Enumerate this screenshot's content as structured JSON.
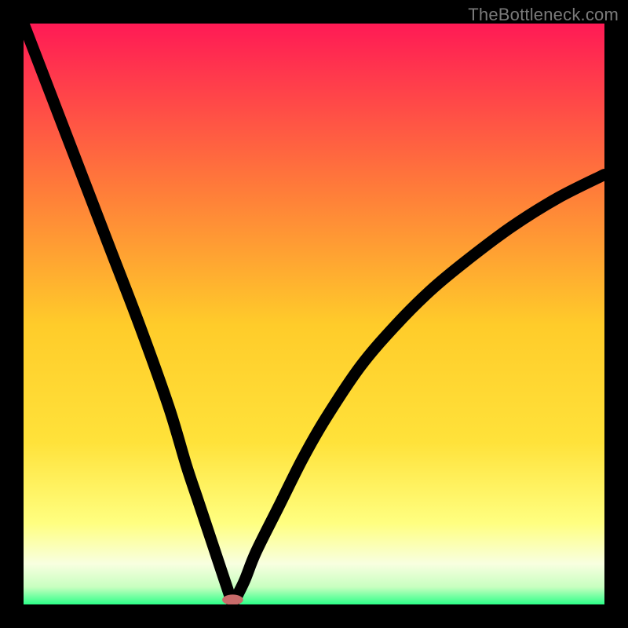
{
  "watermark": "TheBottleneck.com",
  "colors": {
    "frame": "#000000",
    "gradient_top": "#ff1a55",
    "gradient_mid_upper": "#ff9a2a",
    "gradient_mid": "#ffe23a",
    "gradient_lower": "#ffff80",
    "gradient_bottom_band": "#f8ffe0",
    "gradient_base": "#2cff88",
    "curve": "#000000",
    "marker": "#c86b6a"
  },
  "chart_data": {
    "type": "line",
    "title": "",
    "xlabel": "",
    "ylabel": "",
    "xlim": [
      0,
      100
    ],
    "ylim": [
      0,
      100
    ],
    "grid": false,
    "legend": "none",
    "notes": "Single V-shaped curve, two branches interpolated; minimum near x≈36 at y≈0; small rounded marker at the trough.",
    "series": [
      {
        "name": "left-branch",
        "x": [
          0,
          5,
          10,
          15,
          20,
          25,
          28,
          30,
          32,
          34,
          35,
          36
        ],
        "y": [
          100,
          87,
          74,
          61,
          48,
          34,
          24,
          18,
          12,
          6,
          3,
          0
        ]
      },
      {
        "name": "right-branch",
        "x": [
          36,
          38,
          40,
          44,
          48,
          52,
          58,
          64,
          70,
          76,
          84,
          92,
          100
        ],
        "y": [
          0,
          4,
          9,
          17,
          25,
          32,
          41,
          48,
          54,
          59,
          65,
          70,
          74
        ]
      }
    ],
    "marker_center": {
      "x": 36,
      "y": 0.8
    },
    "marker_size": {
      "rx": 1.8,
      "ry": 0.9
    }
  }
}
